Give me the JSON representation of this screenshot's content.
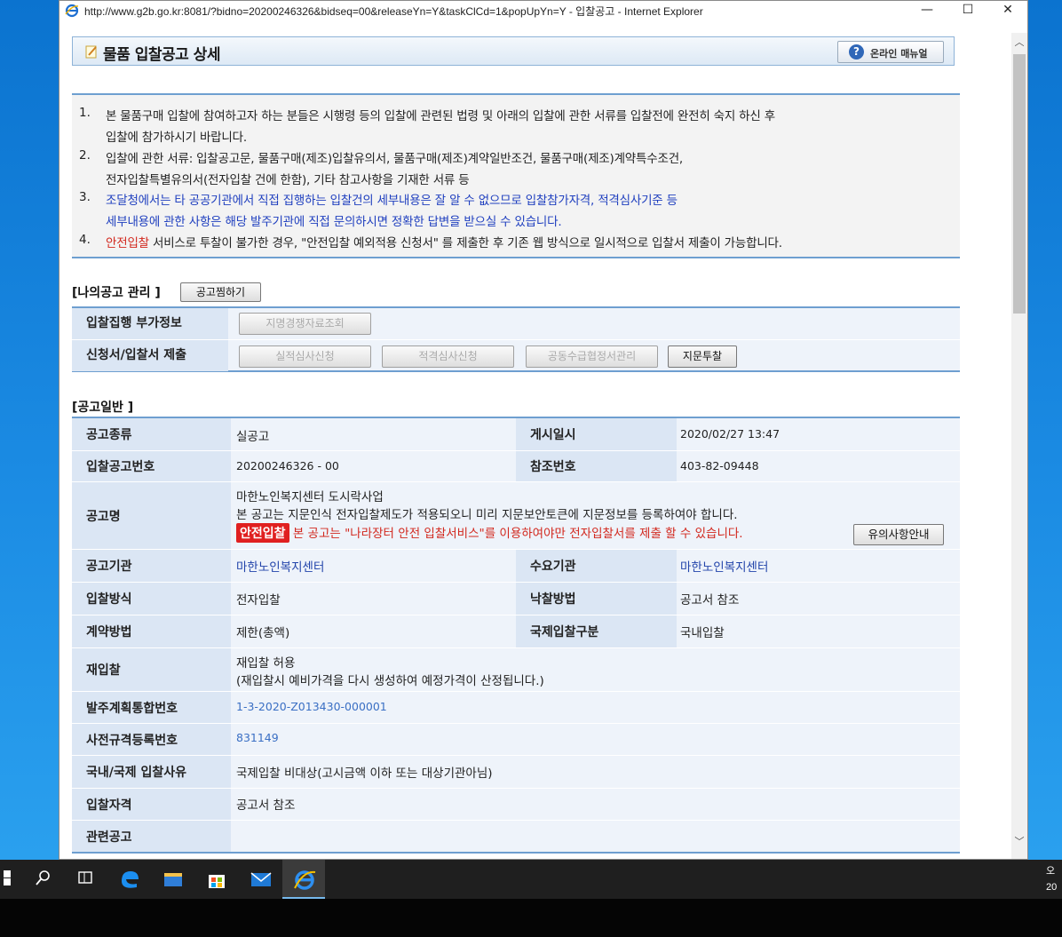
{
  "window": {
    "title": "http://www.g2b.go.kr:8081/?bidno=20200246326&bidseq=00&releaseYn=Y&taskClCd=1&popUpYn=Y - 입찰공고 - Internet Explorer",
    "minimize": "—",
    "maximize": "☐",
    "close": "✕"
  },
  "header": {
    "title": "물품 입찰공고 상세",
    "manual_button": "온라인 매뉴얼"
  },
  "notices": [
    {
      "num": "1.",
      "line1": "본 물품구매 입찰에 참여하고자 하는 분들은 시행령 등의 입찰에 관련된 법령 및 아래의 입찰에 관한 서류를 입찰전에 완전히 숙지 하신 후",
      "line2": "입찰에 참가하시기 바랍니다."
    },
    {
      "num": "2.",
      "line1": "입찰에 관한 서류: 입찰공고문, 물품구매(제조)입찰유의서, 물품구매(제조)계약일반조건, 물품구매(제조)계약특수조건,",
      "line2": "전자입찰특별유의서(전자입찰 건에 한함), 기타 참고사항을 기재한 서류 등"
    },
    {
      "num": "3.",
      "line1": "조달청에서는 타 공공기관에서 직접 집행하는 입찰건의 세부내용은 잘 알 수 없으므로 입찰참가자격, 적격심사기준 등",
      "line2": "세부내용에 관한 사항은 해당 발주기관에 직접 문의하시면 정확한 답변을 받으실 수 있습니다."
    },
    {
      "num": "4.",
      "red": "안전입찰",
      "rest": " 서비스로 투찰이 불가한 경우, \"안전입찰 예외적용 신청서\" 를 제출한 후 기존 웹 방식으로 일시적으로 입찰서 제출이 가능합니다."
    }
  ],
  "my_section": {
    "title": "[나의공고 관리 ]",
    "bookmark_button": "공고찜하기",
    "row1_label": "입찰집행 부가정보",
    "row1_btn": "지명경쟁자료조회",
    "row2_label": "신청서/입찰서 제출",
    "row2_btns": [
      "실적심사신청",
      "적격심사신청",
      "공동수급협정서관리",
      "지문투찰"
    ]
  },
  "general": {
    "title": "[공고일반 ]",
    "rows": {
      "type_label": "공고종류",
      "type_value": "실공고",
      "posted_label": "게시일시",
      "posted_value": "2020/02/27 13:47",
      "bidno_label": "입찰공고번호",
      "bidno_value": "20200246326 - 00",
      "ref_label": "참조번호",
      "ref_value": "403-82-09448",
      "name_label": "공고명",
      "name_value": "마한노인복지센터 도시락사업",
      "name_note": "본 공고는 지문인식 전자입찰제도가 적용되오니 미리 지문보안토큰에 지문정보를 등록하여야 합니다.",
      "safe_badge": "안전입찰",
      "safe_note": "본 공고는 \"나라장터 안전 입찰서비스\"를 이용하여야만 전자입찰서를 제출 할 수 있습니다.",
      "caution_button": "유의사항안내",
      "agency_label": "공고기관",
      "agency_value": "마한노인복지센터",
      "demand_label": "수요기관",
      "demand_value": "마한노인복지센터",
      "method_label": "입찰방식",
      "method_value": "전자입찰",
      "award_label": "낙찰방법",
      "award_value": "공고서 참조",
      "contract_label": "계약방법",
      "contract_value": "제한(총액)",
      "intl_label": "국제입찰구분",
      "intl_value": "국내입찰",
      "rebid_label": "재입찰",
      "rebid_value": "재입찰 허용",
      "rebid_note": "(재입찰시 예비가격을 다시 생성하여 예정가격이 산정됩니다.)",
      "plan_label": "발주계획통합번호",
      "plan_value": "1-3-2020-Z013430-000001",
      "prespec_label": "사전규격등록번호",
      "prespec_value": "831149",
      "reason_label": "국내/국제 입찰사유",
      "reason_value": "국제입찰 비대상(고시금액 이하 또는 대상기관아님)",
      "qual_label": "입찰자격",
      "qual_value": "공고서 참조",
      "related_label": "관련공고",
      "related_value": ""
    }
  },
  "taskbar": {
    "clock_line1": "오",
    "clock_line2": "20"
  }
}
